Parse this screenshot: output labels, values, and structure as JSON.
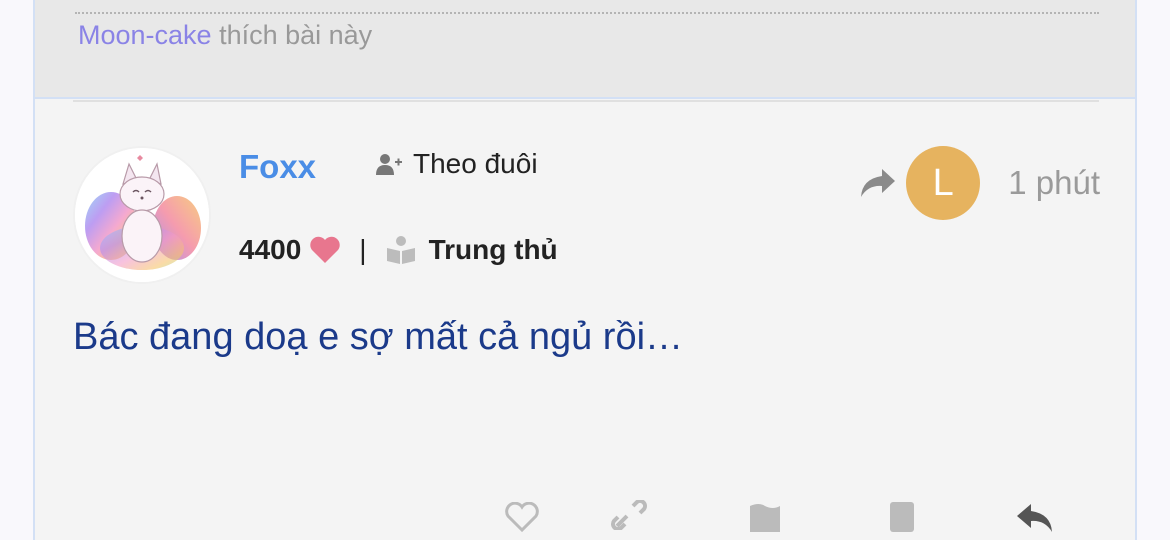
{
  "likes": {
    "name": "Moon-cake",
    "suffix": " thích bài này"
  },
  "post": {
    "username": "Foxx",
    "follow_label": "Theo đuôi",
    "points": "4400",
    "rank": "Trung thủ",
    "avatar_letter": "L",
    "time": "1 phút",
    "content": "Bác đang doạ e sợ mất cả ngủ rồi…"
  },
  "colors": {
    "username": "#4a8de6",
    "like_name": "#8a83e6",
    "content": "#1b3a8a",
    "avatar_letter_bg": "#e6b35f",
    "heart": "#e8768e"
  },
  "icons": [
    "user-plus-icon",
    "heart-icon",
    "book-icon",
    "share-icon",
    "like-icon",
    "link-icon",
    "flag-icon",
    "bookmark-icon",
    "reply-icon"
  ]
}
